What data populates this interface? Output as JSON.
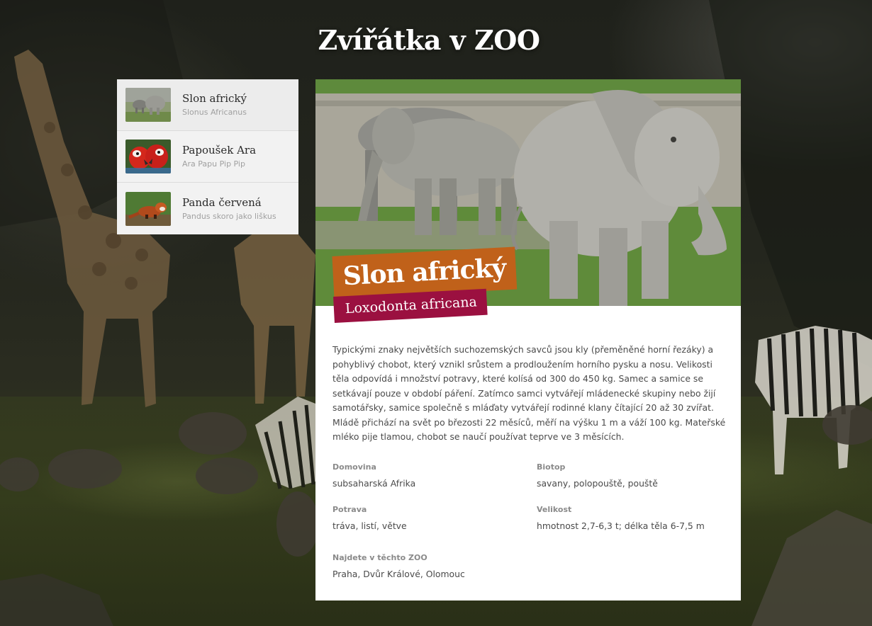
{
  "page": {
    "title": "Zvířátka v ZOO"
  },
  "animals": [
    {
      "name": "Slon africký",
      "latin": "Slonus Africanus",
      "thumb_icon": "elephant-photo",
      "active": true
    },
    {
      "name": "Papoušek Ara",
      "latin": "Ara Papu Pip Pip",
      "thumb_icon": "parrot-photo",
      "active": false
    },
    {
      "name": "Panda červená",
      "latin": "Pandus skoro jako liškus",
      "thumb_icon": "red-panda-photo",
      "active": false
    }
  ],
  "detail": {
    "name": "Slon africký",
    "latin": "Loxodonta africana",
    "photo_icon": "elephants-photo",
    "description": "Typickými znaky největších suchozemských savců jsou kly (přeměněné horní řezáky) a pohyblivý chobot, který vznikl srůstem a prodloužením horního pysku a nosu. Velikosti těla odpovídá i množství potravy, které kolísá od 300 do 450 kg. Samec a samice se setkávají pouze v období páření. Zatímco samci vytvářejí mládenecké skupiny nebo žijí samotářsky, samice společně s mláďaty vytvářejí rodinné klany čítající 20 až 30 zvířat. Mládě přichází na svět po březosti 22 měsíců, měří na výšku 1 m a váží 100 kg. Mateřské mléko pije tlamou, chobot se naučí používat teprve ve 3 měsících.",
    "facts": {
      "domovina": {
        "label": "Domovina",
        "value": "subsaharská Afrika"
      },
      "biotop": {
        "label": "Biotop",
        "value": "savany, polopouště, pouště"
      },
      "potrava": {
        "label": "Potrava",
        "value": "tráva, listí, větve"
      },
      "velikost": {
        "label": "Velikost",
        "value": "hmotnost 2,7-6,3 t; délka těla 6-7,5 m"
      },
      "zoo": {
        "label": "Najdete v těchto ZOO",
        "value": "Praha, Dvůr Králové, Olomouc"
      }
    }
  },
  "colors": {
    "name_badge": "#c0611a",
    "latin_badge": "#9b1040",
    "card_bg": "#ffffff",
    "list_bg": "#f2f2f2"
  }
}
